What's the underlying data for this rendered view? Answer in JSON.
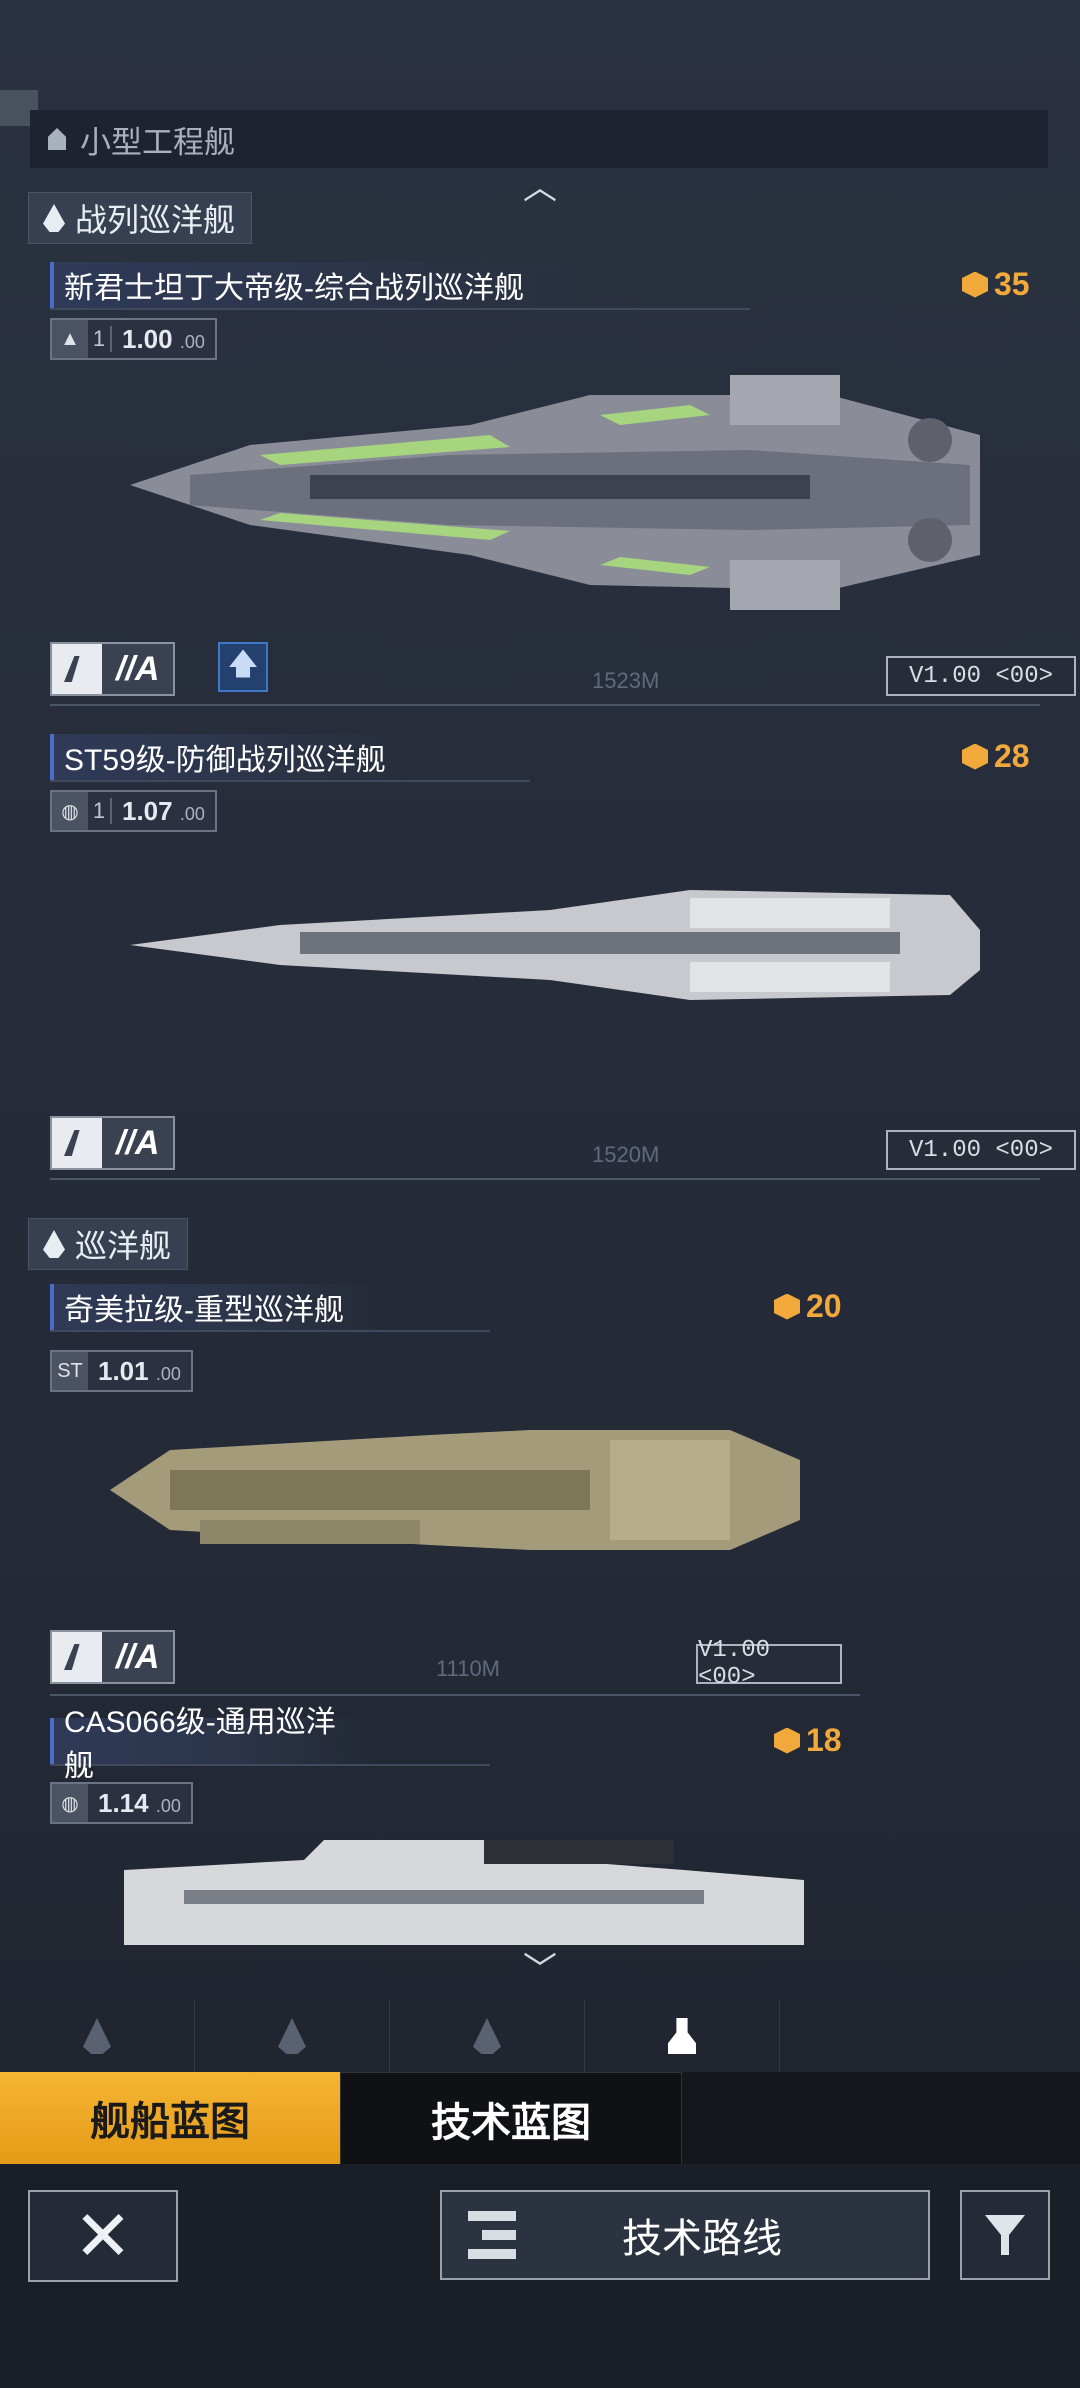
{
  "top_group": {
    "label": "小型工程舰"
  },
  "sections": [
    {
      "label": "战列巡洋舰"
    },
    {
      "label": "巡洋舰"
    }
  ],
  "ships": [
    {
      "name": "新君士坦丁大帝级-综合战列巡洋舰",
      "cost": "35",
      "level": "1",
      "version_main": "1.00",
      "version_sub": "00",
      "grade": "A",
      "length": "1523M",
      "version_tag": "V1.00 <00>"
    },
    {
      "name": "ST59级-防御战列巡洋舰",
      "cost": "28",
      "level": "1",
      "version_main": "1.07",
      "version_sub": "00",
      "grade": "A",
      "length": "1520M",
      "version_tag": "V1.00 <00>"
    },
    {
      "name": "奇美拉级-重型巡洋舰",
      "cost": "20",
      "version_main": "1.01",
      "version_sub": "00",
      "grade": "A",
      "length": "1110M",
      "version_tag": "V1.00 <00>"
    },
    {
      "name": "CAS066级-通用巡洋舰",
      "cost": "18",
      "version_main": "1.14",
      "version_sub": "00"
    }
  ],
  "blueprint_tabs": {
    "ship": "舰船蓝图",
    "tech": "技术蓝图"
  },
  "bottom": {
    "tech_route": "技术路线"
  },
  "colors": {
    "accent": "#f2a93b",
    "background": "#262c39",
    "title_blue": "#4d6cc9"
  }
}
